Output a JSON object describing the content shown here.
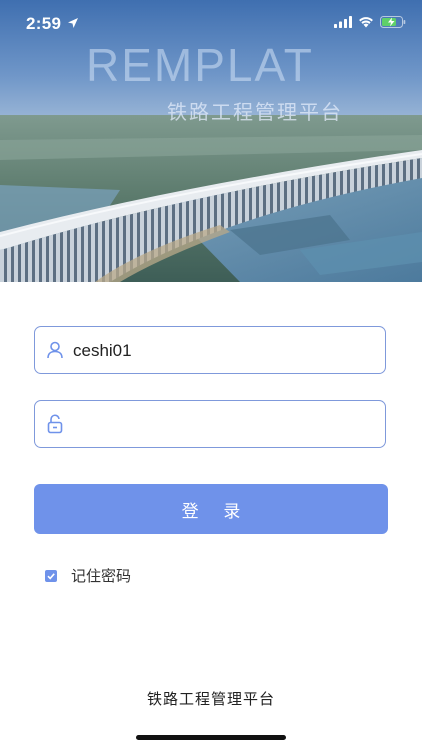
{
  "status_bar": {
    "time": "2:59"
  },
  "hero": {
    "brand": "REMPLAT",
    "subtitle": "铁路工程管理平台"
  },
  "login_form": {
    "username": {
      "value": "ceshi01",
      "placeholder": ""
    },
    "password": {
      "value": "",
      "placeholder": ""
    },
    "submit_label": "登 录",
    "remember_label": "记住密码",
    "remember_checked": true
  },
  "footer": {
    "text": "铁路工程管理平台"
  },
  "colors": {
    "accent": "#6f92ea",
    "field_border": "#7f99db"
  }
}
